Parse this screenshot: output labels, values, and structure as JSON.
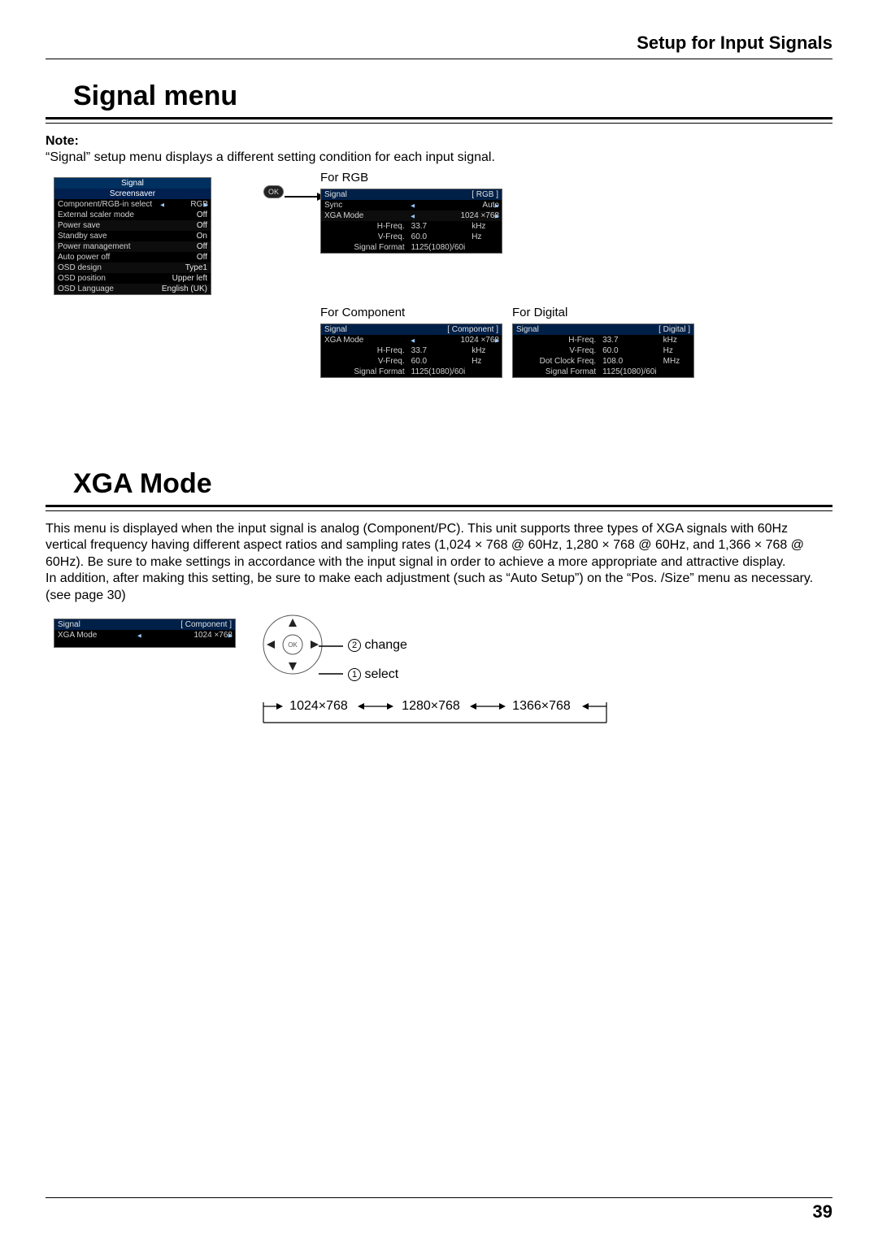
{
  "header": {
    "title": "Setup for Input Signals"
  },
  "section1": {
    "title": "Signal menu",
    "note_label": "Note:",
    "note_text": "“Signal” setup menu displays a different setting condition for each input signal.",
    "captions": {
      "rgb": "For RGB",
      "component": "For Component",
      "digital": "For Digital"
    }
  },
  "osd_main": {
    "title": "Signal",
    "rows": [
      {
        "label": "Screensaver",
        "value": ""
      },
      {
        "label": "Component/RGB-in select",
        "value": "RGB",
        "banded": true
      },
      {
        "label": "External scaler mode",
        "value": "Off"
      },
      {
        "label": "Power save",
        "value": "Off"
      },
      {
        "label": "Standby save",
        "value": "On"
      },
      {
        "label": "Power management",
        "value": "Off"
      },
      {
        "label": "Auto power off",
        "value": "Off"
      },
      {
        "label": "OSD design",
        "value": "Type1"
      },
      {
        "label": "OSD position",
        "value": "Upper left"
      },
      {
        "label": "OSD Language",
        "value": "English (UK)"
      }
    ]
  },
  "ok_label": "OK",
  "osd_rgb": {
    "title": "Signal",
    "bracket": "[ RGB ]",
    "rows": [
      {
        "label": "Sync",
        "value": "Auto",
        "banded": true
      },
      {
        "label": "XGA Mode",
        "value": "1024 ×768",
        "banded": true
      }
    ],
    "info": [
      {
        "label": "H-Freq.",
        "v1": "33.7",
        "v2": "kHz"
      },
      {
        "label": "V-Freq.",
        "v1": "60.0",
        "v2": "Hz"
      },
      {
        "label": "Signal Format",
        "v1": "1125(1080)/60i",
        "v2": ""
      }
    ]
  },
  "osd_comp": {
    "title": "Signal",
    "bracket": "[ Component ]",
    "rows": [
      {
        "label": "XGA Mode",
        "value": "1024 ×768",
        "banded": true
      }
    ],
    "info": [
      {
        "label": "H-Freq.",
        "v1": "33.7",
        "v2": "kHz"
      },
      {
        "label": "V-Freq.",
        "v1": "60.0",
        "v2": "Hz"
      },
      {
        "label": "Signal Format",
        "v1": "1125(1080)/60i",
        "v2": ""
      }
    ]
  },
  "osd_digi": {
    "title": "Signal",
    "bracket": "[ Digital ]",
    "info": [
      {
        "label": "H-Freq.",
        "v1": "33.7",
        "v2": "kHz"
      },
      {
        "label": "V-Freq.",
        "v1": "60.0",
        "v2": "Hz"
      },
      {
        "label": "Dot Clock Freq.",
        "v1": "108.0",
        "v2": "MHz"
      },
      {
        "label": "Signal Format",
        "v1": "1125(1080)/60i",
        "v2": ""
      }
    ]
  },
  "section2": {
    "title": "XGA Mode",
    "para": "This menu is displayed when the input signal is analog (Component/PC). This unit supports three types of XGA signals with 60Hz vertical frequency having different aspect ratios and sampling rates (1,024 × 768 @ 60Hz, 1,280 × 768 @ 60Hz, and 1,366 × 768 @ 60Hz). Be sure to make settings in accordance with the input signal in order to achieve a more appropriate and attractive display.\nIn addition, after making this setting, be sure to make each adjustment (such as “Auto Setup”) on the “Pos. /Size” menu as necessary. (see page 30)"
  },
  "osd_xga": {
    "title": "Signal",
    "bracket": "[ Component ]",
    "rows": [
      {
        "label": "XGA Mode",
        "value": "1024 ×768",
        "banded": true
      }
    ]
  },
  "dpad": {
    "ok": "OK",
    "change_num": "2",
    "change_label": "change",
    "select_num": "1",
    "select_label": "select"
  },
  "cycle": {
    "a": "1024×768",
    "b": "1280×768",
    "c": "1366×768"
  },
  "page_number": "39"
}
